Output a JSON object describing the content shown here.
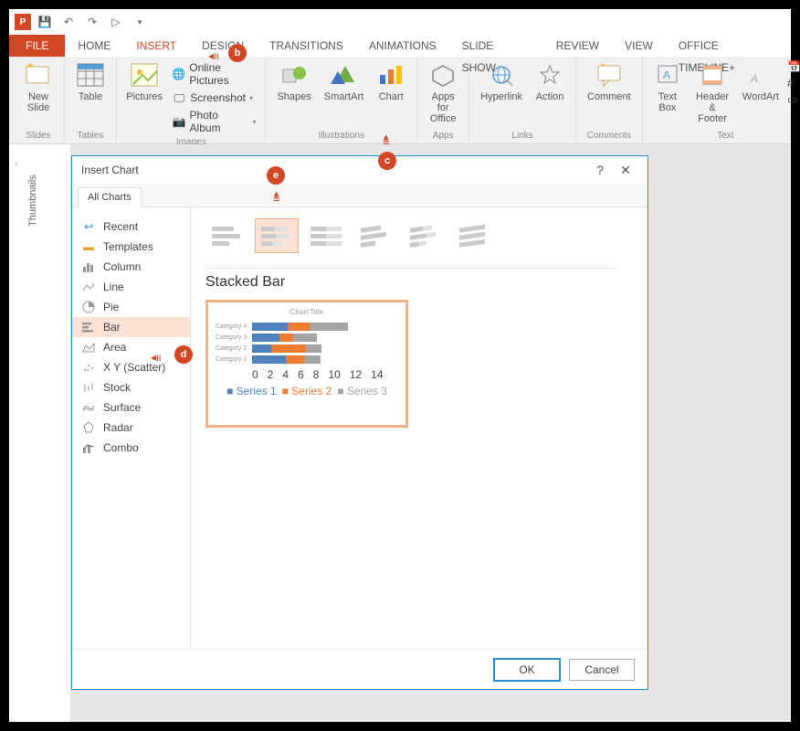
{
  "qat": {
    "icons": [
      "save",
      "undo",
      "redo",
      "start-from-beginning"
    ]
  },
  "tabs": {
    "file": "FILE",
    "items": [
      "HOME",
      "INSERT",
      "DESIGN",
      "TRANSITIONS",
      "ANIMATIONS",
      "SLIDE SHOW",
      "REVIEW",
      "VIEW",
      "OFFICE TIMELINE+"
    ],
    "active": "INSERT"
  },
  "ribbon": {
    "slides": {
      "label": "Slides",
      "new_slide": "New\nSlide"
    },
    "tables": {
      "label": "Tables",
      "table": "Table"
    },
    "images": {
      "label": "Images",
      "pictures": "Pictures",
      "online": "Online Pictures",
      "screenshot": "Screenshot",
      "album": "Photo Album"
    },
    "illustrations": {
      "label": "Illustrations",
      "shapes": "Shapes",
      "smartart": "SmartArt",
      "chart": "Chart"
    },
    "apps": {
      "label": "Apps",
      "apps_for": "Apps for\nOffice"
    },
    "links": {
      "label": "Links",
      "hyperlink": "Hyperlink",
      "action": "Action"
    },
    "comments": {
      "label": "Comments",
      "comment": "Comment"
    },
    "text": {
      "label": "Text",
      "textbox": "Text\nBox",
      "header": "Header\n& Footer",
      "wordart": "WordArt"
    }
  },
  "side": {
    "label": "Thumbnails"
  },
  "dialog": {
    "title": "Insert Chart",
    "tab": "All Charts",
    "categories": [
      "Recent",
      "Templates",
      "Column",
      "Line",
      "Pie",
      "Bar",
      "Area",
      "X Y (Scatter)",
      "Stock",
      "Surface",
      "Radar",
      "Combo"
    ],
    "selected_category": "Bar",
    "subtype_title": "Stacked Bar",
    "ok": "OK",
    "cancel": "Cancel",
    "help": "?",
    "close": "✕"
  },
  "chart_data": {
    "type": "bar",
    "orientation": "horizontal",
    "stacked": true,
    "title": "Chart Title",
    "categories": [
      "Category 4",
      "Category 3",
      "Category 2",
      "Category 1"
    ],
    "series": [
      {
        "name": "Series 1",
        "values": [
          4.5,
          3.5,
          2.5,
          4.3
        ],
        "color": "#4f81bd"
      },
      {
        "name": "Series 2",
        "values": [
          2.8,
          1.8,
          4.4,
          2.4
        ],
        "color": "#ed7d31"
      },
      {
        "name": "Series 3",
        "values": [
          5.0,
          3.0,
          2.0,
          2.0
        ],
        "color": "#a5a5a5"
      }
    ],
    "xticks": [
      0,
      2,
      4,
      6,
      8,
      10,
      12,
      14
    ],
    "xlim": [
      0,
      14
    ]
  },
  "callouts": {
    "b": "b",
    "c": "c",
    "d": "d",
    "e": "e"
  }
}
